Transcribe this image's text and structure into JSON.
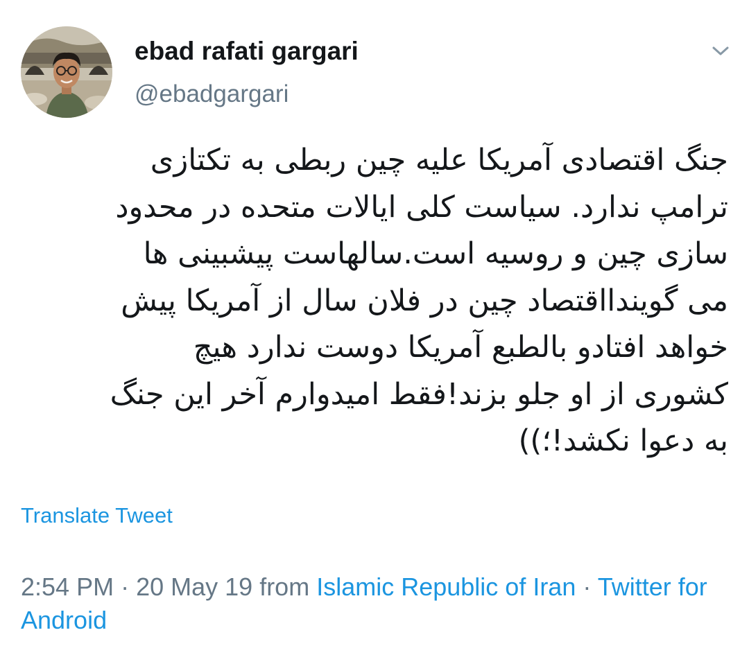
{
  "author": {
    "display_name": "ebad rafati gargari",
    "handle": "@ebadgargari",
    "avatar_icon": "profile-photo"
  },
  "menu_icon": "chevron-down-icon",
  "tweet": {
    "text": "جنگ اقتصادی آمریکا علیه چین ربطی به تکتازی\nترامپ ندارد. سیاست کلی ایالات متحده در محدود\nسازی چین و روسیه است.سالهاست پیشبینی ها\nمی گویندااقتصاد چین در فلان سال از آمریکا پیش\nخواهد افتادو بالطبع آمریکا دوست ندارد هیچ\nکشوری از او جلو بزند!فقط امیدوارم آخر این جنگ\nبه دعوا نکشد!؛))",
    "translate_label": "Translate Tweet"
  },
  "meta": {
    "time": "2:54 PM",
    "separator": " · ",
    "date": "20 May 19",
    "from": " from ",
    "location": "Islamic Republic of Iran",
    "separator2": " · ",
    "source": "Twitter for Android"
  },
  "colors": {
    "link": "#1b95e0",
    "secondary": "#657786",
    "primary": "#14171a"
  }
}
